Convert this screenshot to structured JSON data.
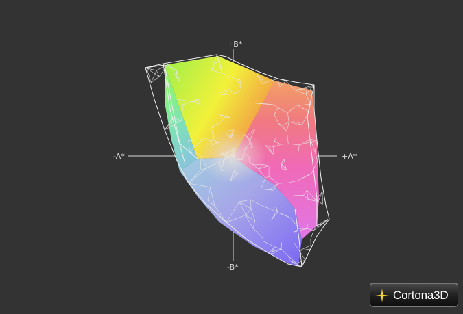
{
  "axes": {
    "b_plus": "+B*",
    "b_minus": "-B*",
    "a_minus": "-A*",
    "a_plus": "+A*"
  },
  "logo": {
    "name": "Cortona",
    "suffix": "3D"
  },
  "colors": {
    "background": "#333333",
    "wireframe": "#e6e6e6",
    "axis": "#d8d8d8"
  }
}
